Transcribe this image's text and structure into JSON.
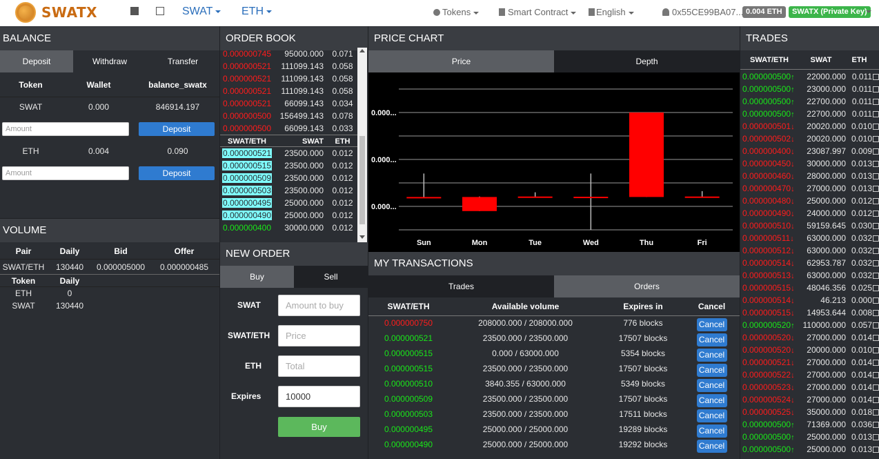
{
  "app": {
    "logo": "SWATX",
    "menu_swat": "SWAT",
    "menu_eth": "ETH",
    "tokens": "Tokens",
    "smart_contract": "Smart Contract",
    "language": "English",
    "account": "0x55CE99BA07...",
    "eth_balance": "0.004 ETH",
    "key_badge": "SWATX (Private Key)"
  },
  "balance": {
    "title": "BALANCE",
    "tabs": [
      "Deposit",
      "Withdraw",
      "Transfer"
    ],
    "headers": [
      "Token",
      "Wallet",
      "balance_swatx"
    ],
    "rows": [
      {
        "token": "SWAT",
        "wallet": "0.000",
        "balance": "846914.197"
      },
      {
        "token": "ETH",
        "wallet": "0.004",
        "balance": "0.090"
      }
    ],
    "amount_placeholder": "Amount",
    "deposit_label": "Deposit"
  },
  "volume": {
    "title": "VOLUME",
    "headers": [
      "Pair",
      "Daily",
      "Bid",
      "Offer"
    ],
    "pair_row": {
      "pair": "SWAT/ETH",
      "daily": "130440",
      "bid": "0.000005000",
      "offer": "0.000000485"
    },
    "token_headers": [
      "Token",
      "Daily"
    ],
    "token_rows": [
      {
        "token": "ETH",
        "daily": "0"
      },
      {
        "token": "SWAT",
        "daily": "130440"
      }
    ]
  },
  "orderbook": {
    "title": "ORDER BOOK",
    "asks": [
      [
        "0.000000745",
        "95000.000",
        "0.071"
      ],
      [
        "0.000000521",
        "111099.143",
        "0.058"
      ],
      [
        "0.000000521",
        "111099.143",
        "0.058"
      ],
      [
        "0.000000521",
        "111099.143",
        "0.058"
      ],
      [
        "0.000000521",
        "66099.143",
        "0.034"
      ],
      [
        "0.000000500",
        "156499.143",
        "0.078"
      ],
      [
        "0.000000500",
        "66099.143",
        "0.033"
      ]
    ],
    "headers": [
      "SWAT/ETH",
      "SWAT",
      "ETH"
    ],
    "bids": [
      [
        "0.000000521",
        "23500.000",
        "0.012"
      ],
      [
        "0.000000515",
        "23500.000",
        "0.012"
      ],
      [
        "0.000000509",
        "23500.000",
        "0.012"
      ],
      [
        "0.000000503",
        "23500.000",
        "0.012"
      ],
      [
        "0.000000495",
        "25000.000",
        "0.012"
      ],
      [
        "0.000000490",
        "25000.000",
        "0.012"
      ],
      [
        "0.000000400",
        "30000.000",
        "0.012"
      ]
    ]
  },
  "new_order": {
    "title": "NEW ORDER",
    "tabs": [
      "Buy",
      "Sell"
    ],
    "labels": {
      "swat": "SWAT",
      "pair": "SWAT/ETH",
      "eth": "ETH",
      "expires": "Expires"
    },
    "placeholders": {
      "amount": "Amount to buy",
      "price": "Price",
      "total": "Total"
    },
    "expires_value": "10000",
    "buy_button": "Buy"
  },
  "price_chart": {
    "title": "PRICE CHART",
    "tabs": [
      "Price",
      "Depth"
    ]
  },
  "chart_data": {
    "type": "candlestick",
    "categories": [
      "Sun",
      "Mon",
      "Tue",
      "Wed",
      "Thu",
      "Fri"
    ],
    "ytick_labels": [
      "0.000...",
      "0.000...",
      "0.000..."
    ],
    "series": [
      {
        "open": 0.4,
        "close": 0.39,
        "high": 1.4,
        "low": 0.38
      },
      {
        "open": 0.4,
        "close": -0.2,
        "high": 0.42,
        "low": -0.2
      },
      {
        "open": 0.39,
        "close": 0.42,
        "high": 0.6,
        "low": 0.39
      },
      {
        "open": 0.41,
        "close": 0.39,
        "high": 1.4,
        "low": -1.0
      },
      {
        "open": 4.0,
        "close": 0.4,
        "high": 4.0,
        "low": 0.4
      },
      {
        "open": 0.42,
        "close": 0.39,
        "high": 0.65,
        "low": 0.39
      }
    ],
    "ylim": [
      -1.0,
      5.0
    ],
    "grid": true,
    "colors": {
      "candle": "#ff0000",
      "wick": "#bbbbbb",
      "background": "#000000",
      "grid": "#9a9a9a"
    }
  },
  "my_transactions": {
    "title": "MY TRANSACTIONS",
    "tabs": [
      "Trades",
      "Orders"
    ],
    "headers": [
      "SWAT/ETH",
      "Available volume",
      "Expires in",
      "Cancel"
    ],
    "cancel_label": "Cancel",
    "rows": [
      {
        "price": "0.000000750",
        "side": "red",
        "volume": "208000.000 / 208000.000",
        "expires": "776 blocks"
      },
      {
        "price": "0.000000521",
        "side": "green",
        "volume": "23500.000 / 23500.000",
        "expires": "17507 blocks"
      },
      {
        "price": "0.000000515",
        "side": "green",
        "volume": "0.000 / 63000.000",
        "expires": "5354 blocks"
      },
      {
        "price": "0.000000515",
        "side": "green",
        "volume": "23500.000 / 23500.000",
        "expires": "17507 blocks"
      },
      {
        "price": "0.000000510",
        "side": "green",
        "volume": "3840.355 / 63000.000",
        "expires": "5349 blocks"
      },
      {
        "price": "0.000000509",
        "side": "green",
        "volume": "23500.000 / 23500.000",
        "expires": "17507 blocks"
      },
      {
        "price": "0.000000503",
        "side": "green",
        "volume": "23500.000 / 23500.000",
        "expires": "17511 blocks"
      },
      {
        "price": "0.000000495",
        "side": "green",
        "volume": "25000.000 / 25000.000",
        "expires": "19289 blocks"
      },
      {
        "price": "0.000000490",
        "side": "green",
        "volume": "25000.000 / 25000.000",
        "expires": "19292 blocks"
      }
    ]
  },
  "trades": {
    "title": "TRADES",
    "headers": [
      "SWAT/ETH",
      "SWAT",
      "ETH"
    ],
    "rows": [
      {
        "price": "0.000000500",
        "dir": "up",
        "swat": "22000.000",
        "eth": "0.011"
      },
      {
        "price": "0.000000500",
        "dir": "up",
        "swat": "23000.000",
        "eth": "0.011"
      },
      {
        "price": "0.000000500",
        "dir": "up",
        "swat": "22700.000",
        "eth": "0.011"
      },
      {
        "price": "0.000000500",
        "dir": "up",
        "swat": "22700.000",
        "eth": "0.011"
      },
      {
        "price": "0.000000501",
        "dir": "down",
        "swat": "20020.000",
        "eth": "0.010"
      },
      {
        "price": "0.000000502",
        "dir": "down",
        "swat": "20020.000",
        "eth": "0.010"
      },
      {
        "price": "0.000000400",
        "dir": "down",
        "swat": "23087.997",
        "eth": "0.009"
      },
      {
        "price": "0.000000450",
        "dir": "down",
        "swat": "30000.000",
        "eth": "0.013"
      },
      {
        "price": "0.000000460",
        "dir": "down",
        "swat": "28000.000",
        "eth": "0.013"
      },
      {
        "price": "0.000000470",
        "dir": "down",
        "swat": "27000.000",
        "eth": "0.013"
      },
      {
        "price": "0.000000480",
        "dir": "down",
        "swat": "25000.000",
        "eth": "0.012"
      },
      {
        "price": "0.000000490",
        "dir": "down",
        "swat": "24000.000",
        "eth": "0.012"
      },
      {
        "price": "0.000000510",
        "dir": "down",
        "swat": "59159.645",
        "eth": "0.030"
      },
      {
        "price": "0.000000511",
        "dir": "down",
        "swat": "63000.000",
        "eth": "0.032"
      },
      {
        "price": "0.000000512",
        "dir": "down",
        "swat": "63000.000",
        "eth": "0.032"
      },
      {
        "price": "0.000000514",
        "dir": "down",
        "swat": "62953.787",
        "eth": "0.032"
      },
      {
        "price": "0.000000513",
        "dir": "down",
        "swat": "63000.000",
        "eth": "0.032"
      },
      {
        "price": "0.000000515",
        "dir": "down",
        "swat": "48046.356",
        "eth": "0.025"
      },
      {
        "price": "0.000000514",
        "dir": "down",
        "swat": "46.213",
        "eth": "0.000"
      },
      {
        "price": "0.000000515",
        "dir": "down",
        "swat": "14953.644",
        "eth": "0.008"
      },
      {
        "price": "0.000000520",
        "dir": "up",
        "swat": "110000.000",
        "eth": "0.057"
      },
      {
        "price": "0.000000520",
        "dir": "down",
        "swat": "27000.000",
        "eth": "0.014"
      },
      {
        "price": "0.000000520",
        "dir": "down",
        "swat": "20000.000",
        "eth": "0.010"
      },
      {
        "price": "0.000000521",
        "dir": "down",
        "swat": "27000.000",
        "eth": "0.014"
      },
      {
        "price": "0.000000522",
        "dir": "down",
        "swat": "27000.000",
        "eth": "0.014"
      },
      {
        "price": "0.000000523",
        "dir": "down",
        "swat": "27000.000",
        "eth": "0.014"
      },
      {
        "price": "0.000000524",
        "dir": "down",
        "swat": "27000.000",
        "eth": "0.014"
      },
      {
        "price": "0.000000525",
        "dir": "down",
        "swat": "35000.000",
        "eth": "0.018"
      },
      {
        "price": "0.000000500",
        "dir": "up",
        "swat": "71369.000",
        "eth": "0.036"
      },
      {
        "price": "0.000000500",
        "dir": "up",
        "swat": "25000.000",
        "eth": "0.013"
      },
      {
        "price": "0.000000500",
        "dir": "up",
        "swat": "25000.000",
        "eth": "0.013"
      }
    ]
  }
}
